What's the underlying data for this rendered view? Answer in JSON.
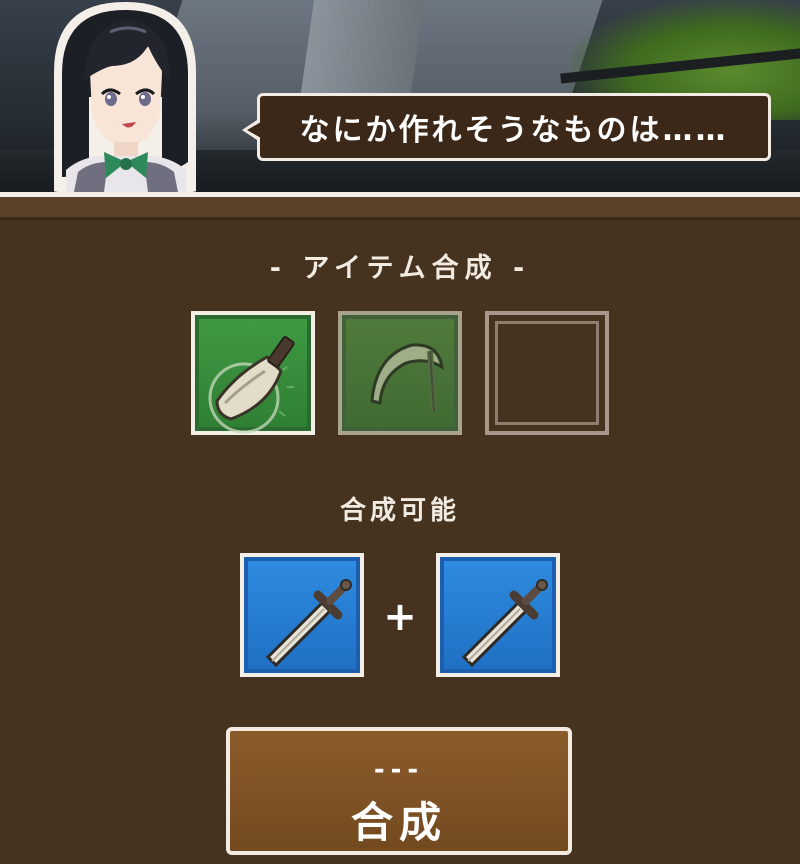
{
  "dialogue": {
    "text": "なにか作れそうなものは……"
  },
  "panel": {
    "title": "- アイテム合成 -",
    "craftable_label": "合成可能"
  },
  "materials": [
    {
      "icon": "cleaver-icon",
      "state": "selected"
    },
    {
      "icon": "scythe-icon",
      "state": "available"
    },
    {
      "icon": "empty-slot",
      "state": "empty"
    }
  ],
  "result_recipe": [
    {
      "icon": "sword-icon"
    },
    {
      "icon": "sword-icon"
    }
  ],
  "result_plus": "+",
  "craft_button": {
    "cost": "---",
    "label": "合成"
  },
  "colors": {
    "panel_bg": "#46331f",
    "slot_green": "#3f9a43",
    "slot_blue": "#2f8ce0",
    "button_brown": "#8a5b2a"
  }
}
